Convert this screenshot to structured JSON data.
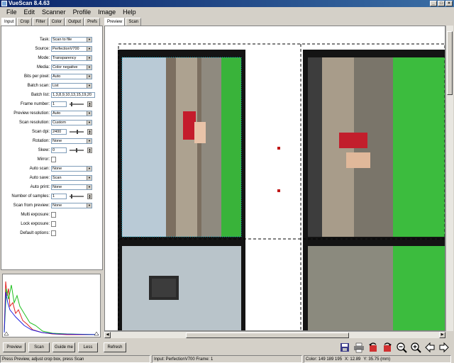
{
  "window": {
    "title": "VueScan 8.4.63"
  },
  "menu": [
    "File",
    "Edit",
    "Scanner",
    "Profile",
    "Image",
    "Help"
  ],
  "left_tabs": [
    "Input",
    "Crop",
    "Filter",
    "Color",
    "Output",
    "Prefs"
  ],
  "right_tabs": [
    "Preview",
    "Scan"
  ],
  "settings": {
    "task": {
      "label": "Task:",
      "value": "Scan to file"
    },
    "source": {
      "label": "Source:",
      "value": "PerfectionV700"
    },
    "mode": {
      "label": "Mode:",
      "value": "Transparency"
    },
    "media": {
      "label": "Media:",
      "value": "Color negative"
    },
    "bits": {
      "label": "Bits per pixel:",
      "value": "Auto"
    },
    "batch_scan": {
      "label": "Batch scan:",
      "value": "List"
    },
    "batch_list": {
      "label": "Batch list:",
      "value": "1,3,8,9,10,13,15,19,20"
    },
    "frame_number": {
      "label": "Frame number:",
      "value": "1"
    },
    "preview_res": {
      "label": "Preview resolution:",
      "value": "Auto"
    },
    "scan_res": {
      "label": "Scan resolution:",
      "value": "Custom"
    },
    "scan_dpi": {
      "label": "Scan dpi:",
      "value": "2400"
    },
    "rotation": {
      "label": "Rotation:",
      "value": "None"
    },
    "skew": {
      "label": "Skew:",
      "value": "0"
    },
    "mirror": {
      "label": "Mirror:"
    },
    "auto_scan": {
      "label": "Auto scan:",
      "value": "None"
    },
    "auto_save": {
      "label": "Auto save:",
      "value": "Scan"
    },
    "auto_print": {
      "label": "Auto print:",
      "value": "None"
    },
    "num_samples": {
      "label": "Number of samples:",
      "value": "1"
    },
    "scan_from_preview": {
      "label": "Scan from preview:",
      "value": "None"
    },
    "multi_exposure": {
      "label": "Multi exposure:"
    },
    "lock_exposure": {
      "label": "Lock exposure:"
    },
    "default_options": {
      "label": "Default options:"
    }
  },
  "buttons": {
    "preview": "Preview",
    "scan": "Scan",
    "guide_me": "Guide me",
    "less": "Less",
    "refresh": "Refresh"
  },
  "toolbar_icons": [
    "save-icon",
    "print-icon",
    "rotate-left-icon",
    "rotate-right-icon",
    "zoom-out-icon",
    "zoom-in-icon",
    "back-arrow-icon",
    "forward-arrow-icon"
  ],
  "status": {
    "hint": "Press Preview, adjust crop box, press Scan",
    "input": "Input: PerfectionV700 Frame: 1",
    "color": "Color: 149 189 195",
    "x": "X: 12.89",
    "y": "Y: 35.75 (mm)"
  },
  "colors": {
    "title_bar": "#0a246a",
    "panel_bg": "#d4d0c8",
    "histogram_red": "#e02020",
    "histogram_green": "#20c020",
    "histogram_blue": "#2020e0"
  }
}
